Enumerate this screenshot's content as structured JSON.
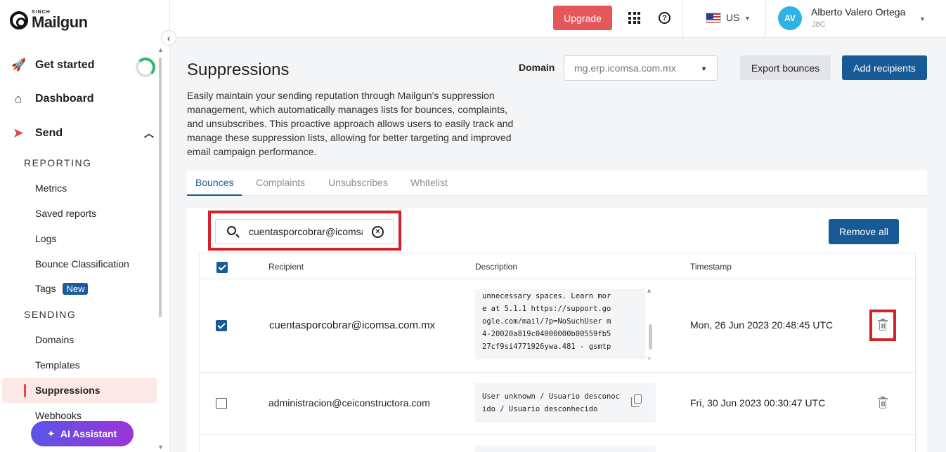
{
  "brand": {
    "small": "SINCH",
    "name": "Mailgun"
  },
  "sidebar": {
    "get_started": "Get started",
    "dashboard": "Dashboard",
    "send": "Send",
    "reporting_header": "REPORTING",
    "reporting_items": [
      "Metrics",
      "Saved reports",
      "Logs",
      "Bounce Classification",
      "Tags"
    ],
    "tags_badge": "New",
    "sending_header": "SENDING",
    "sending_items": [
      "Domains",
      "Templates",
      "Suppressions",
      "Webhooks"
    ],
    "active_item": "Suppressions",
    "ai_assistant": "AI Assistant"
  },
  "topbar": {
    "upgrade": "Upgrade",
    "region": "US",
    "avatar_initials": "AV",
    "user_name": "Alberto Valero Ortega",
    "user_org": "J8C"
  },
  "page": {
    "title": "Suppressions",
    "description": "Easily maintain your sending reputation through Mailgun's suppression management, which automatically manages lists for bounces, complaints, and unsubscribes. This proactive approach allows users to easily track and manage these suppression lists, allowing for better targeting and improved email campaign performance.",
    "domain_label": "Domain",
    "domain_value": "mg.erp.icomsa.com.mx",
    "export_bounces": "Export bounces",
    "add_recipients": "Add recipients"
  },
  "tabs": [
    "Bounces",
    "Complaints",
    "Unsubscribes",
    "Whitelist"
  ],
  "active_tab": "Bounces",
  "search": {
    "value": "cuentasporcobrar@icomsa"
  },
  "remove_all": "Remove all",
  "table": {
    "headers": {
      "recipient": "Recipient",
      "description": "Description",
      "timestamp": "Timestamp"
    },
    "rows": [
      {
        "recipient": "cuentasporcobrar@icomsa.com.mx",
        "description_lines": [
          "unnecessary spaces. Learn mor",
          "e at 5.1.1 https://support.go",
          "ogle.com/mail/?p=NoSuchUser m",
          "4-20020a819c04000000b00559fb5",
          "27cf9si4771926ywa.481 - gsmtp"
        ],
        "timestamp": "Mon, 26 Jun 2023 20:48:45 UTC",
        "checked": true
      },
      {
        "recipient": "administracion@ceiconstructora.com",
        "description_lines": [
          "User unknown / Usuario desconoc",
          "ido / Usuario desconhecido"
        ],
        "timestamp": "Fri, 30 Jun 2023 00:30:47 UTC",
        "checked": false
      }
    ]
  },
  "colors": {
    "accent": "#175a95",
    "upgrade": "#e5575b",
    "highlight": "#d9202a"
  }
}
